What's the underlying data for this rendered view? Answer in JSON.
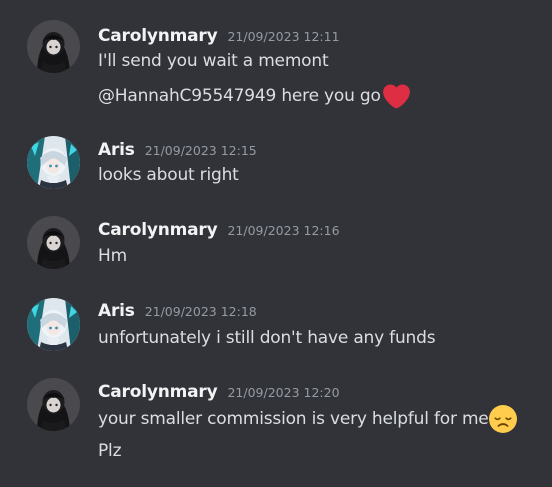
{
  "messages": [
    {
      "author": "Carolynmary",
      "timestamp": "21/09/2023 12:11",
      "avatar": "carolynmary-avatar",
      "lines": [
        {
          "text": "I'll send you wait a memont"
        },
        {
          "text": "@HannahC95547949 here you go",
          "emoji": "red-heart-icon"
        }
      ]
    },
    {
      "author": "Aris",
      "timestamp": "21/09/2023 12:15",
      "avatar": "aris-avatar",
      "lines": [
        {
          "text": "looks about right"
        }
      ]
    },
    {
      "author": "Carolynmary",
      "timestamp": "21/09/2023 12:16",
      "avatar": "carolynmary-avatar",
      "lines": [
        {
          "text": "Hm"
        }
      ]
    },
    {
      "author": "Aris",
      "timestamp": "21/09/2023 12:18",
      "avatar": "aris-avatar",
      "lines": [
        {
          "text": "unfortunately i still don't have any funds"
        }
      ]
    },
    {
      "author": "Carolynmary",
      "timestamp": "21/09/2023 12:20",
      "avatar": "carolynmary-avatar",
      "lines": [
        {
          "text": "your smaller commission is very helpful for me",
          "emoji": "disappointed-face-icon"
        },
        {
          "text": "Plz"
        }
      ]
    }
  ],
  "colors": {
    "background": "#313338",
    "username": "#f2f3f5",
    "timestamp": "#949ba4",
    "message_text": "#dbdee1",
    "heart": "#dd2e44",
    "emoji_face": "#ffcc4d"
  }
}
